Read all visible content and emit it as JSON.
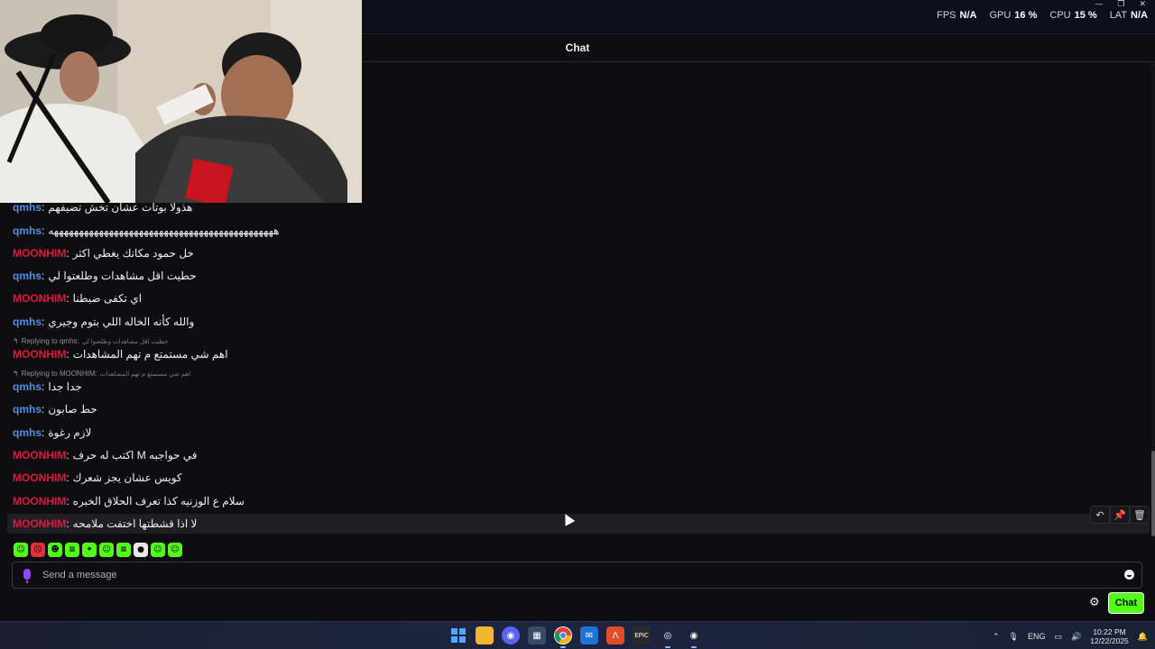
{
  "stats": {
    "fps_label": "FPS",
    "fps_value": "N/A",
    "gpu_label": "GPU",
    "gpu_value": "16 %",
    "cpu_label": "CPU",
    "cpu_value": "15 %",
    "lat_label": "LAT",
    "lat_value": "N/A"
  },
  "chat": {
    "title": "Chat",
    "messages": [
      {
        "user": "qmhs",
        "text": "هذولا بوتات عشان تخش تضيفهم",
        "color": "#4f8fe8"
      },
      {
        "user": "qmhs",
        "text": "هههههههههههههههههههههههههههههههههههههههههههههه",
        "color": "#4f8fe8"
      },
      {
        "user": "MOONHIM",
        "text": "خل حمود مكانك يغطي اكثر",
        "color": "#e0163f"
      },
      {
        "user": "qmhs",
        "text": "حطيت اقل مشاهدات وطلعتوا لي",
        "color": "#4f8fe8"
      },
      {
        "user": "MOONHIM",
        "text": "اي تكفى ضبطنا",
        "color": "#e0163f"
      },
      {
        "user": "qmhs",
        "text": "والله كأنه الخاله اللي بتوم وجيري",
        "color": "#4f8fe8"
      },
      {
        "user": "MOONHIM",
        "text": "اهم شي مستمتع م تهم المشاهدات",
        "color": "#e0163f"
      },
      {
        "user": "qmhs",
        "text": "جدا جدا",
        "color": "#4f8fe8"
      },
      {
        "user": "qmhs",
        "text": "حط صابون",
        "color": "#4f8fe8"
      },
      {
        "user": "qmhs",
        "text": "لازم رغوة",
        "color": "#4f8fe8"
      },
      {
        "user": "MOONHIM",
        "text": "في حواجبه M اكتب له حرف",
        "color": "#e0163f"
      },
      {
        "user": "MOONHIM",
        "text": "كويس عشان يجز شعرك",
        "color": "#e0163f"
      },
      {
        "user": "MOONHIM",
        "text": "سلام ع الوزنيه كذا تعرف الحلاق الخبره",
        "color": "#e0163f"
      },
      {
        "user": "MOONHIM",
        "text": "لا اذا قشطتها اختفت ملامحه",
        "color": "#e0163f"
      }
    ],
    "replies": [
      {
        "label": "Replying to qmhs:",
        "quote": "حطيت اقل مشاهدات وطلعتوا لي"
      },
      {
        "label": "Replying to MOONHIM:",
        "quote": "اهم شي مستمتع م تهم المشاهدات"
      }
    ],
    "input_placeholder": "Send a message",
    "send_label": "Chat"
  },
  "emotes": [
    "#53fc18",
    "#e0323c",
    "#53fc18",
    "#53fc18",
    "#53fc18",
    "#53fc18",
    "#53fc18",
    "#e8e8e8",
    "#53fc18",
    "#53fc18"
  ],
  "taskbar": {
    "lang": "ENG",
    "time": "10:22 PM",
    "date": "12/22/2025"
  }
}
